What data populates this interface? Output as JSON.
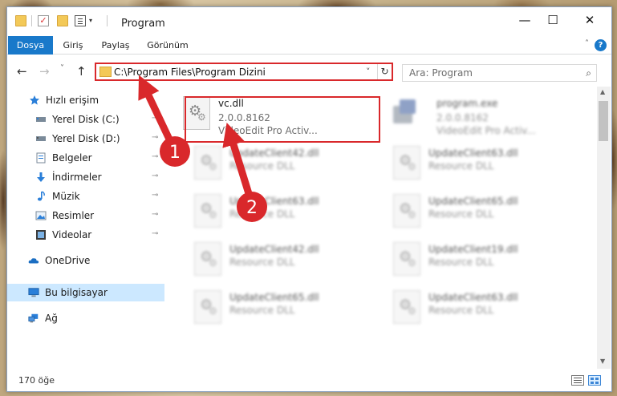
{
  "window": {
    "title": "Program",
    "controls": {
      "minimize": "—",
      "maximize": "☐",
      "close": "✕"
    }
  },
  "quick_access_toolbar": {
    "check_glyph": "✓",
    "dropdown_glyph": "▾"
  },
  "ribbon": {
    "tabs": [
      "Dosya",
      "Giriş",
      "Paylaş",
      "Görünüm"
    ],
    "active_tab": "Dosya",
    "help": "?",
    "collapse_glyph": "˄",
    "accent_color": "#1979ca"
  },
  "navigation": {
    "back": "←",
    "forward": "→",
    "recent": "˅",
    "up": "↑",
    "address": "C:\\Program Files\\Program Dizini",
    "address_dropdown": "˅",
    "refresh": "↻",
    "search_placeholder": "Ara: Program",
    "search_glyph": "⌕"
  },
  "sidebar": {
    "items": [
      {
        "label": "Hızlı erişim",
        "icon": "star-icon",
        "pinned": false
      },
      {
        "label": "Yerel Disk (C:)",
        "icon": "drive-icon",
        "pinned": true
      },
      {
        "label": "Yerel Disk (D:)",
        "icon": "drive-icon",
        "pinned": true
      },
      {
        "label": "Belgeler",
        "icon": "document-icon",
        "pinned": true
      },
      {
        "label": "İndirmeler",
        "icon": "download-icon",
        "pinned": true
      },
      {
        "label": "Müzik",
        "icon": "music-icon",
        "pinned": true
      },
      {
        "label": "Resimler",
        "icon": "pictures-icon",
        "pinned": true
      },
      {
        "label": "Videolar",
        "icon": "video-icon",
        "pinned": true
      },
      {
        "label": "OneDrive",
        "icon": "cloud-icon",
        "pinned": false
      },
      {
        "label": "Bu bilgisayar",
        "icon": "computer-icon",
        "pinned": false,
        "selected": true
      },
      {
        "label": "Ağ",
        "icon": "network-icon",
        "pinned": false
      }
    ],
    "pin_glyph": "📌"
  },
  "files": [
    {
      "name": "vc.dll",
      "line2": "2.0.0.8162",
      "line3": "VideoEdit Pro Activ...",
      "type": "dll",
      "highlighted": true
    },
    {
      "name": "program.exe",
      "line2": "2.0.0.8162",
      "line3": "VideoEdit Pro Activ...",
      "type": "exe",
      "blurred": true
    },
    {
      "name": "UpdateClient42.dll",
      "line2": "Resource DLL",
      "type": "dll",
      "blurred": true
    },
    {
      "name": "UpdateClient63.dll",
      "line2": "Resource DLL",
      "type": "dll",
      "blurred": true
    },
    {
      "name": "UpdateClient63.dll",
      "line2": "Resource DLL",
      "type": "dll",
      "blurred": true
    },
    {
      "name": "UpdateClient65.dll",
      "line2": "Resource DLL",
      "type": "dll",
      "blurred": true
    },
    {
      "name": "UpdateClient42.dll",
      "line2": "Resource DLL",
      "type": "dll",
      "blurred": true
    },
    {
      "name": "UpdateClient19.dll",
      "line2": "Resource DLL",
      "type": "dll",
      "blurred": true
    },
    {
      "name": "UpdateClient65.dll",
      "line2": "Resource DLL",
      "type": "dll",
      "blurred": true
    },
    {
      "name": "UpdateClient63.dll",
      "line2": "Resource DLL",
      "type": "dll",
      "blurred": true
    }
  ],
  "status_bar": {
    "item_count": "170 öğe"
  },
  "annotations": {
    "step1": "1",
    "step2": "2",
    "color": "#d9282b"
  }
}
